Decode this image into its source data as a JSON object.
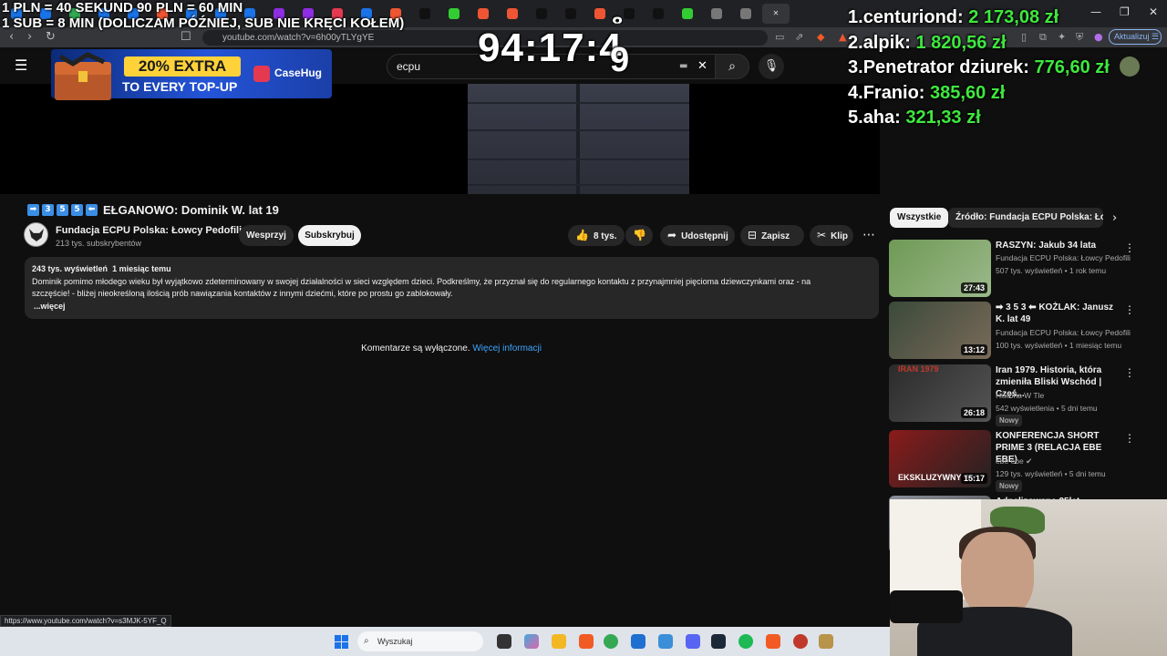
{
  "browser": {
    "tab_count": 27,
    "url": "youtube.com/watch?v=6h00yTLYgYE",
    "update_label": "Aktualizuj",
    "status_url": "https://www.youtube.com/watch?v=s3MJK-5YF_Q"
  },
  "overlay": {
    "line1": "1 PLN =  40 SEKUND 90 PLN = 60 MIN",
    "line2": "1 SUB = 8 MIN (DOLICZAM PÓŹNIEJ, SUB NIE KRĘCI KOŁEM)",
    "timer": "94:17:4",
    "timer_digit_next": "9",
    "timer_digit_prev": "8",
    "leaderboard": [
      {
        "rank": "1.",
        "name": "centuriond:",
        "amount": "2 173,08 zł"
      },
      {
        "rank": "2.",
        "name": "alpik:",
        "amount": "1 820,56 zł"
      },
      {
        "rank": "3.",
        "name": "Penetrator dziurek:",
        "amount": "776,60 zł"
      },
      {
        "rank": "4.",
        "name": "Franio:",
        "amount": "385,60 zł"
      },
      {
        "rank": "5.",
        "name": "aha:",
        "amount": "321,33 zł"
      }
    ],
    "ad": {
      "extra": "20% EXTRA",
      "every": "TO EVERY TOP-UP",
      "brand": "CaseHug"
    }
  },
  "youtube": {
    "search_value": "ecpu",
    "video": {
      "title": "EŁGANOWO: Dominik W. lat 19",
      "title_emoji": [
        "➡",
        "3",
        "5",
        "5",
        "⬅"
      ],
      "channel": "Fundacja ECPU Polska: Łowcy Pedofili",
      "subscribers": "213 tys. subskrybentów",
      "support_label": "Wesprzyj",
      "subscribe_label": "Subskrybuj",
      "likes": "8 tys.",
      "share_label": "Udostępnij",
      "save_label": "Zapisz",
      "clip_label": "Klip",
      "views": "243 tys. wyświetleń",
      "date": "1 miesiąc temu",
      "description_line1": "Dominik pomimo młodego wieku był wyjątkowo zdeterminowany w swojej działalności w sieci względem dzieci. Podkreślmy, że przyznał się do regularnego kontaktu z przynajmniej pięcioma dziewczynkami oraz - na",
      "description_line2": "szczęście! - bliżej nieokreśloną ilością prób nawiązania kontaktów z innymi dziećmi, które po prostu go zablokowały.",
      "more_label": "...więcej",
      "comments_off": "Komentarze są wyłączone.",
      "comments_link": "Więcej informacji"
    },
    "chips": [
      "Wszystkie",
      "Źródło: Fundacja ECPU Polska: Łowcy Pedofili"
    ],
    "related": [
      {
        "title": "RASZYN: Jakub 34 lata",
        "channel": "Fundacja ECPU Polska: Łowcy Pedofili",
        "meta": "507 tys. wyświetleń • 1 rok temu",
        "duration": "27:43",
        "badge": ""
      },
      {
        "title": "➡ 3 5 3 ⬅ KOŻLAK: Janusz K. lat 49",
        "channel": "Fundacja ECPU Polska: Łowcy Pedofili",
        "meta": "100 tys. wyświetleń • 1 miesiąc temu",
        "duration": "13:12",
        "badge": ""
      },
      {
        "title": "Iran 1979. Historia, która zmieniła Bliski Wschód | Częś...",
        "channel": "Historia W Tle",
        "meta": "542 wyświetlenia • 5 dni temu",
        "duration": "26:18",
        "badge": "Nowy",
        "thumb_text": "IRAN 1979"
      },
      {
        "title": "KONFERENCJA SHORT PRIME 3 (RELACJA EBE EBE)",
        "channel": "ebe ebe ✔",
        "meta": "129 tys. wyświetleń • 5 dni temu",
        "duration": "15:17",
        "badge": "Nowy",
        "thumb_text": "EKSKLUZYWNY WY..."
      },
      {
        "title": "Adnalizowane 25lat... Współpraca",
        "channel": "",
        "meta": "",
        "duration": "",
        "badge": ""
      }
    ]
  },
  "taskbar": {
    "search_placeholder": "Wyszukaj"
  },
  "colors": {
    "leaderboard_amount": "#3ee83e",
    "yt_background": "#0f0f0f",
    "link": "#3ea6ff"
  }
}
